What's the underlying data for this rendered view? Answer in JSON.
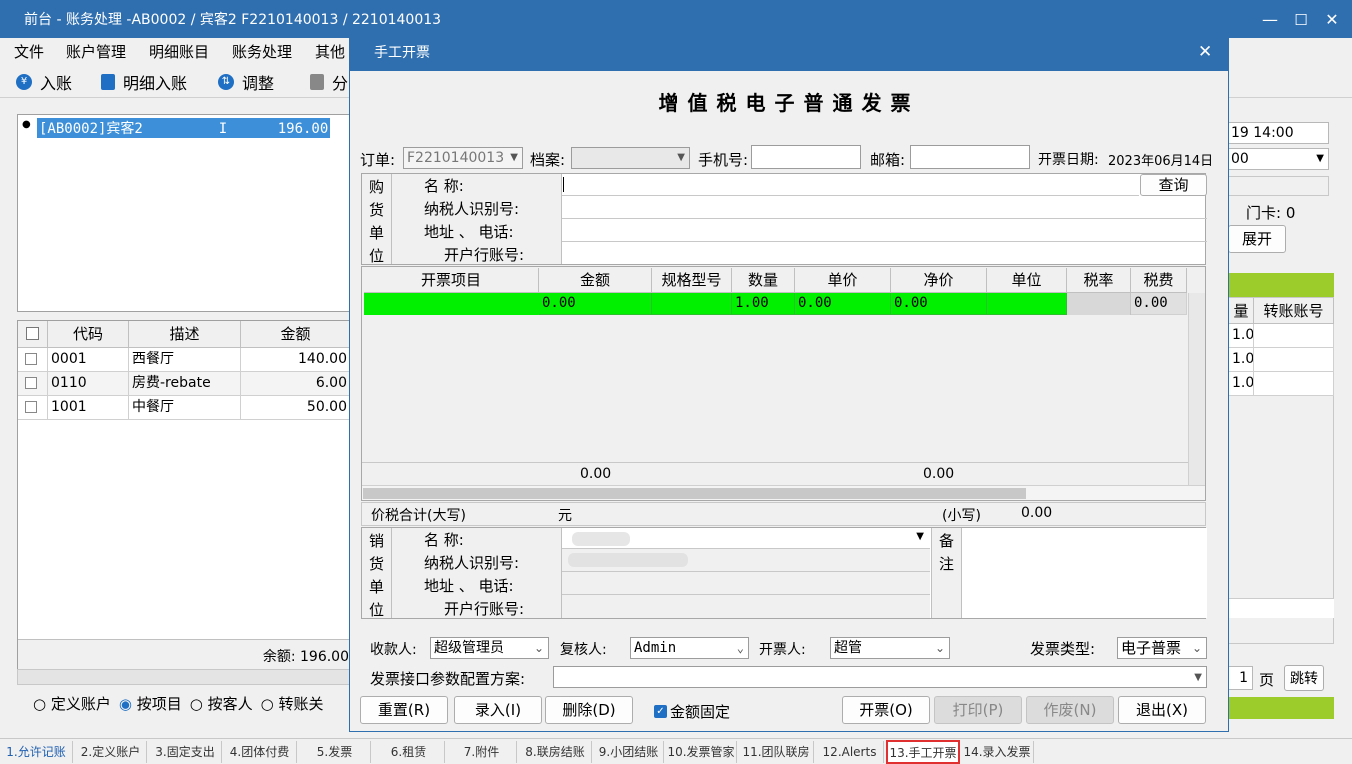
{
  "window": {
    "title": "前台 - 账务处理 -AB0002 / 宾客2 F2210140013 / 2210140013"
  },
  "menu": [
    "文件",
    "账户管理",
    "明细账目",
    "账务处理",
    "其他"
  ],
  "toolbar": {
    "post": "入账",
    "detail_post": "明细入账",
    "adjust": "调整",
    "split": "分"
  },
  "accounts": {
    "selected": "[AB0002]宾客2         I      196.00"
  },
  "items": {
    "headers": [
      "代码",
      "描述",
      "金额"
    ],
    "rows": [
      {
        "code": "0001",
        "desc": "西餐厅",
        "amount": "140.00"
      },
      {
        "code": "0110",
        "desc": "房费-rebate",
        "amount": "6.00"
      },
      {
        "code": "1001",
        "desc": "中餐厅",
        "amount": "50.00"
      }
    ],
    "balance": "余额: 196.00"
  },
  "radios": {
    "custom": "定义账户",
    "by_item": "按项目",
    "by_guest": "按客人",
    "transfer": "转账关"
  },
  "right": {
    "time": "19 14:00",
    "combo": "00",
    "card": "门卡: 0",
    "expand": "展开",
    "col1": "量",
    "col2": "转账账号",
    "rows": [
      "1.0",
      "1.0",
      "1.0"
    ],
    "page_num": "1",
    "page": "页",
    "jump": "跳转"
  },
  "tabs": [
    "1.允许记账",
    "2.定义账户",
    "3.固定支出",
    "4.团体付费",
    "5.发票",
    "6.租赁",
    "7.附件",
    "8.联房结账",
    "9.小团结账",
    "10.发票管家",
    "11.团队联房",
    "12.Alerts",
    "13.手工开票",
    "14.录入发票"
  ],
  "dialog": {
    "title": "手工开票",
    "heading": "增值税电子普通发票",
    "order_label": "订单:",
    "order_value": "F2210140013",
    "file_label": "档案:",
    "phone_label": "手机号:",
    "email_label": "邮箱:",
    "date_label": "开票日期:",
    "date_value": "2023年06月14日",
    "buyer_side": [
      "购",
      "货",
      "单",
      "位"
    ],
    "buyer_labels": {
      "name": "名        称:",
      "tax_id": "纳税人识别号:",
      "addr": "地址 、 电话:",
      "bank": "开户行账号:"
    },
    "query": "查询",
    "grid_headers": [
      "开票项目",
      "金额",
      "规格型号",
      "数量",
      "单价",
      "净价",
      "单位",
      "税率",
      "税费"
    ],
    "grid_row": {
      "amount": "0.00",
      "qty": "1.00",
      "price": "0.00",
      "net": "0.00",
      "tax": "0.00"
    },
    "totals": {
      "amount": "0.00",
      "net": "0.00"
    },
    "sum_label": "价税合计(大写)",
    "sum_unit": "元",
    "small_label": "(小写)",
    "small_value": "0.00",
    "seller_side": [
      "销",
      "货",
      "单",
      "位"
    ],
    "note_side": [
      "备",
      "注"
    ],
    "payee_label": "收款人:",
    "payee": "超级管理员",
    "reviewer_label": "复核人:",
    "reviewer": "Admin",
    "issuer_label": "开票人:",
    "issuer": "超管",
    "type_label": "发票类型:",
    "type": "电子普票",
    "config_label": "发票接口参数配置方案:",
    "buttons": {
      "reset": "重置(R)",
      "enter": "录入(I)",
      "delete": "删除(D)",
      "fixed": "金额固定",
      "issue": "开票(O)",
      "print": "打印(P)",
      "void": "作废(N)",
      "exit": "退出(X)"
    }
  }
}
